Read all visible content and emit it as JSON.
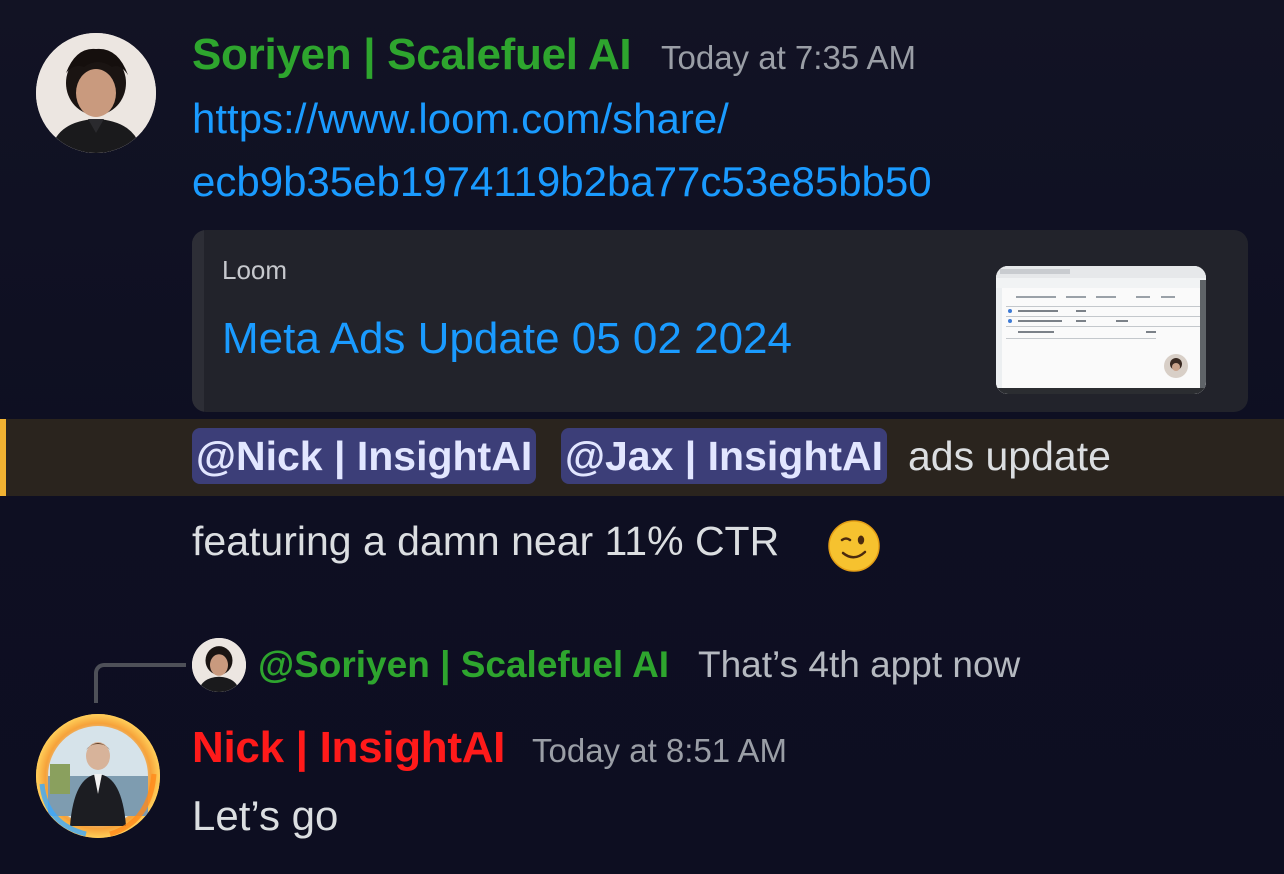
{
  "messages": [
    {
      "author": "Soriyen | Scalefuel AI",
      "author_color": "#2ea52e",
      "timestamp": "Today at 7:35 AM",
      "link_line1": "https://www.loom.com/share/",
      "link_line2": "ecb9b35eb1974119b2ba77c53e85bb50",
      "embed": {
        "provider": "Loom",
        "title": "Meta Ads Update 05 02 2024"
      },
      "mentions": [
        "@Nick | InsightAI",
        "@Jax | InsightAI"
      ],
      "text_after_mentions": "ads update",
      "text_line2": "featuring a damn near 11% CTR",
      "emoji": "wink-emoji"
    },
    {
      "reply_to_user": "@Soriyen | Scalefuel AI",
      "reply_to_text": "That’s 4th appt now",
      "author": "Nick | InsightAI",
      "author_color": "#ff1a1a",
      "timestamp": "Today at 8:51 AM",
      "text": "Let’s go"
    }
  ],
  "colors": {
    "link": "#1a9bff",
    "mention_bg": "#3c3e78",
    "highlight_bar": "#f0b232"
  }
}
